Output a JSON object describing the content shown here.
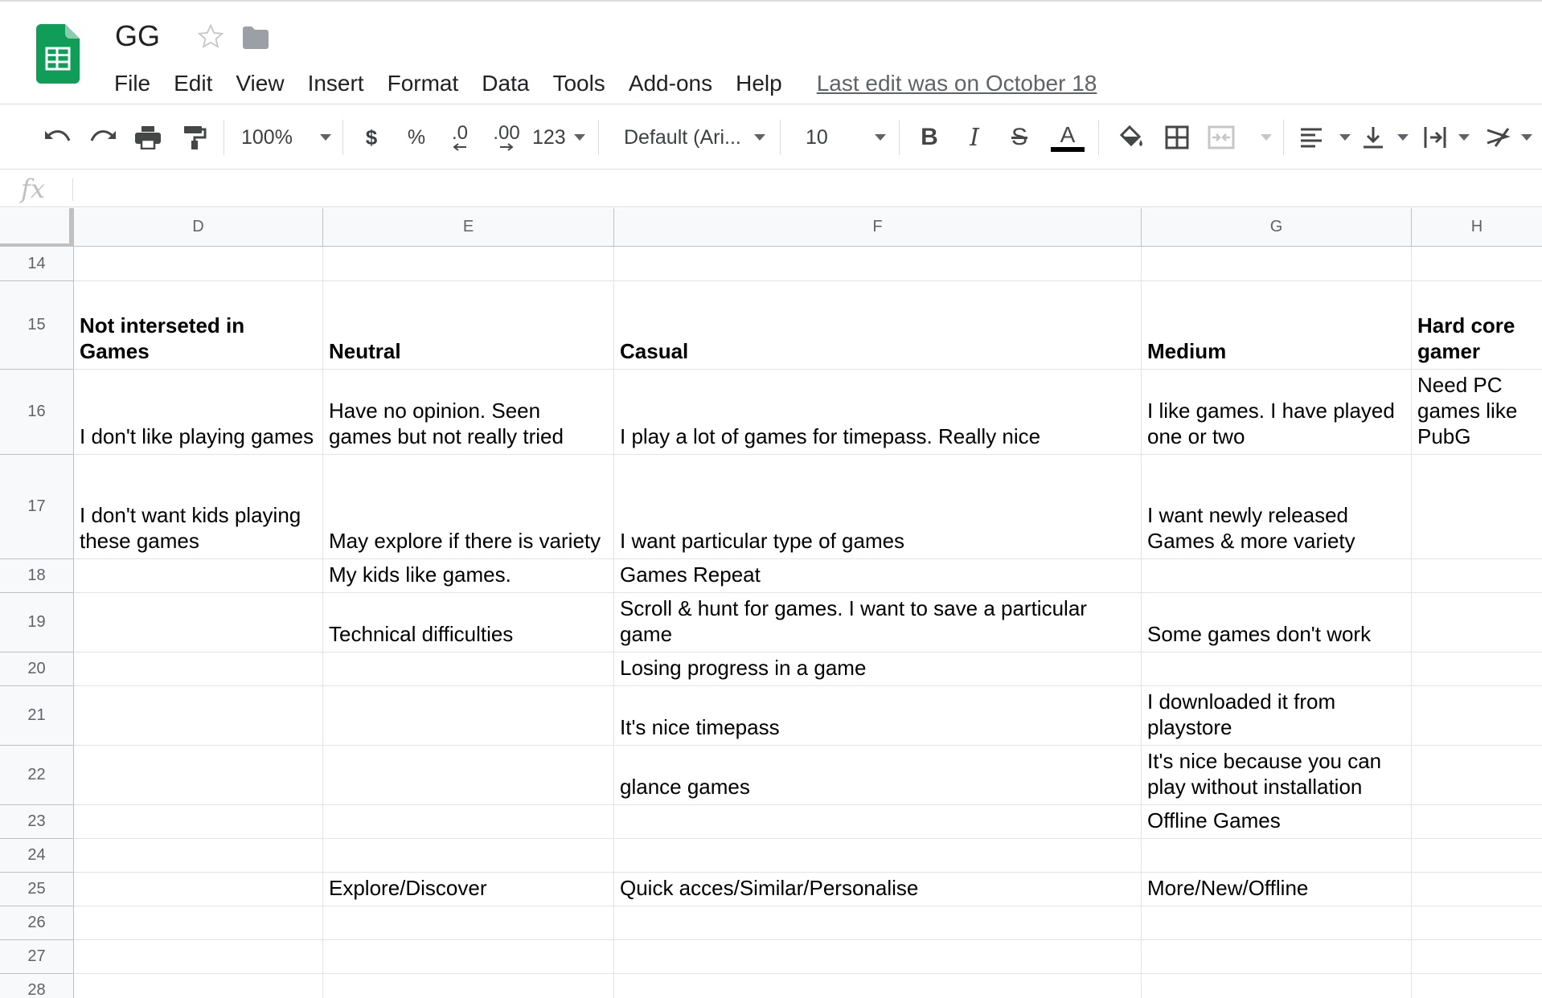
{
  "document": {
    "title": "GG",
    "last_edit": "Last edit was on October 18"
  },
  "menu": [
    "File",
    "Edit",
    "View",
    "Insert",
    "Format",
    "Data",
    "Tools",
    "Add-ons",
    "Help"
  ],
  "toolbar": {
    "zoom": "100%",
    "currency": "$",
    "percent": "%",
    "decrease_decimal": ".0",
    "increase_decimal": ".00",
    "more_formats": "123",
    "font": "Default (Ari...",
    "font_size": "10",
    "bold": "B",
    "italic": "I",
    "strikethrough": "S",
    "text_color_glyph": "A",
    "text_color": "#000000"
  },
  "formula_bar": {
    "label": "fx",
    "value": ""
  },
  "colors": {
    "sheets_green": "#0f9d58",
    "header_bg": "#f8f9fa",
    "grid_line": "#e2e3e3"
  },
  "columns": [
    "D",
    "E",
    "F",
    "G",
    "H"
  ],
  "rows": [
    {
      "num": "14",
      "cells": [
        "",
        "",
        "",
        "",
        ""
      ]
    },
    {
      "num": "15",
      "cells": [
        "Not interseted in\nGames",
        "Neutral",
        "Casual",
        "Medium",
        "Hard core\ngamer"
      ]
    },
    {
      "num": "16",
      "cells": [
        "I don't like playing games",
        "Have no opinion. Seen\ngames but not really tried",
        "I play a lot of games for timepass. Really nice",
        "I like games. I have played\none or two",
        "Need PC\ngames like\nPubG"
      ]
    },
    {
      "num": "17",
      "cells": [
        "I don't want kids playing\nthese games",
        "May explore if there is variety",
        "I want particular type of games",
        "I want newly released\nGames & more variety",
        ""
      ]
    },
    {
      "num": "18",
      "cells": [
        "",
        "My kids like games.",
        "Games Repeat",
        "",
        ""
      ]
    },
    {
      "num": "19",
      "cells": [
        "",
        "Technical difficulties",
        "Scroll & hunt for games. I want to save a particular\ngame",
        "Some games don't work",
        ""
      ]
    },
    {
      "num": "20",
      "cells": [
        "",
        "",
        "Losing progress in a game",
        "",
        ""
      ]
    },
    {
      "num": "21",
      "cells": [
        "",
        "",
        "It's nice timepass",
        "I downloaded it from\nplaystore",
        ""
      ]
    },
    {
      "num": "22",
      "cells": [
        "",
        "",
        "glance games",
        "It's nice because you can\nplay without installation",
        ""
      ]
    },
    {
      "num": "23",
      "cells": [
        "",
        "",
        "",
        "Offline Games",
        ""
      ]
    },
    {
      "num": "24",
      "cells": [
        "",
        "",
        "",
        "",
        ""
      ]
    },
    {
      "num": "25",
      "cells": [
        "",
        "Explore/Discover",
        "Quick acces/Similar/Personalise",
        "More/New/Offline",
        ""
      ]
    },
    {
      "num": "26",
      "cells": [
        "",
        "",
        "",
        "",
        ""
      ]
    },
    {
      "num": "27",
      "cells": [
        "",
        "",
        "",
        "",
        ""
      ]
    },
    {
      "num": "28",
      "cells": [
        "",
        "",
        "",
        "",
        ""
      ]
    }
  ]
}
